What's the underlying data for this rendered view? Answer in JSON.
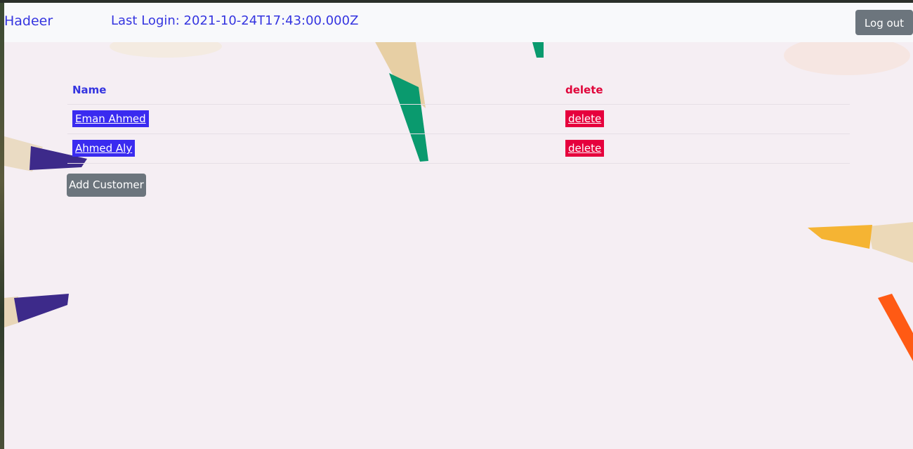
{
  "navbar": {
    "brand": "Hadeer",
    "last_login_label": "Last Login: 2021-10-24T17:43:00.000Z",
    "logout_label": "Log out"
  },
  "table": {
    "headers": {
      "name": "Name",
      "delete": "delete"
    },
    "rows": [
      {
        "name": "Eman Ahmed",
        "delete": "delete"
      },
      {
        "name": "Ahmed Aly",
        "delete": "delete"
      }
    ]
  },
  "actions": {
    "add_customer_label": "Add Customer"
  },
  "colors": {
    "link_blue": "#3535e0",
    "name_bg": "#3a2bf0",
    "delete_red": "#e6003d",
    "button_gray": "#6c757d",
    "navbar_bg": "#f8f9fb",
    "page_bg": "#f5eef3"
  },
  "background": {
    "image": "colored-pencils"
  }
}
